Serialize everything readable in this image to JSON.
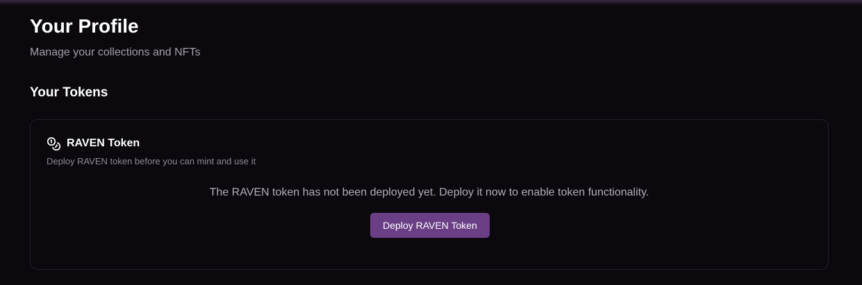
{
  "header": {
    "title": "Your Profile",
    "subtitle": "Manage your collections and NFTs"
  },
  "tokens_section": {
    "title": "Your Tokens",
    "card": {
      "icon": "coins-icon",
      "title": "RAVEN Token",
      "description": "Deploy RAVEN token before you can mint and use it",
      "message": "The RAVEN token has not been deployed yet. Deploy it now to enable token functionality.",
      "button_label": "Deploy RAVEN Token"
    }
  },
  "colors": {
    "background": "#0b090e",
    "accent_button": "#6a3f86",
    "card_border": "#25222b"
  }
}
